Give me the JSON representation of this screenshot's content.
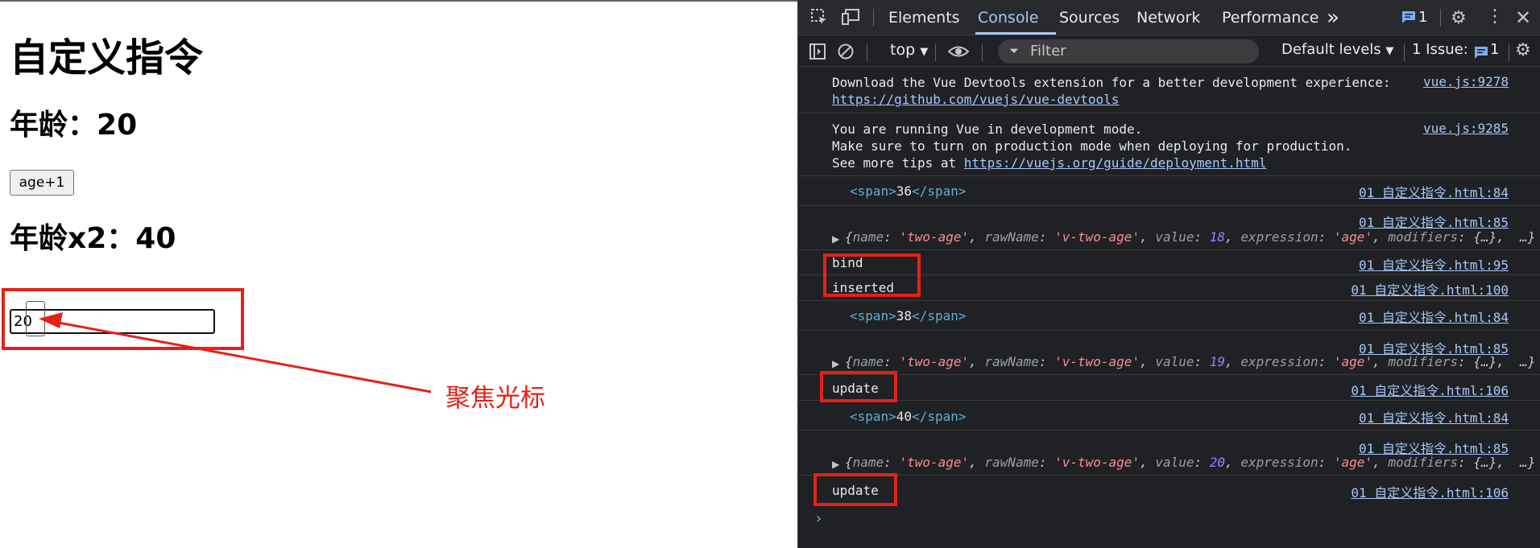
{
  "page": {
    "title": "自定义指令",
    "age_label": "年龄：",
    "age_value": "20",
    "button_label": "age+1",
    "double_label": "年龄x2：",
    "double_value": "40",
    "input_value": "20",
    "annotation": "聚焦光标",
    "annotation_color": "#e52117"
  },
  "devtools": {
    "tabs": [
      "Elements",
      "Console",
      "Sources",
      "Network",
      "Performance"
    ],
    "active_tab": "Console",
    "more_tabs": "»",
    "issues_badge": "1",
    "toolbar": {
      "context": "top",
      "filter_placeholder": "Filter",
      "levels": "Default levels",
      "issues_label": "1 Issue:",
      "issues_count": "1"
    },
    "messages": {
      "m1_line1": "Download the Vue Devtools extension for a better development experience:",
      "m1_link": "https://github.com/vuejs/vue-devtools",
      "m1_src": "vue.js:9278",
      "m2_line1": "You are running Vue in development mode.",
      "m2_line2": "Make sure to turn on production mode when deploying for production.",
      "m2_line3_prefix": "See more tips at ",
      "m2_link": "https://vuejs.org/guide/deployment.html",
      "m2_src": "vue.js:9285",
      "span1_value": "36",
      "span2_value": "38",
      "span3_value": "40",
      "src_84": "01 自定义指令.html:84",
      "src_85": "01 自定义指令.html:85",
      "src_95": "01 自定义指令.html:95",
      "src_100": "01 自定义指令.html:100",
      "src_106": "01 自定义指令.html:106",
      "bind": "bind",
      "inserted": "inserted",
      "update": "update",
      "obj_name_key": "name",
      "obj_name_val": "'two-age'",
      "obj_raw_key": "rawName",
      "obj_raw_val": "'v-two-age'",
      "obj_value_key": "value",
      "obj_value_1": "18",
      "obj_value_2": "19",
      "obj_value_3": "20",
      "obj_expr_key": "expression",
      "obj_expr_val": "'age'",
      "obj_mod_key": "modifiers",
      "obj_mod_val": "{…}",
      "obj_tail": "…}"
    }
  }
}
